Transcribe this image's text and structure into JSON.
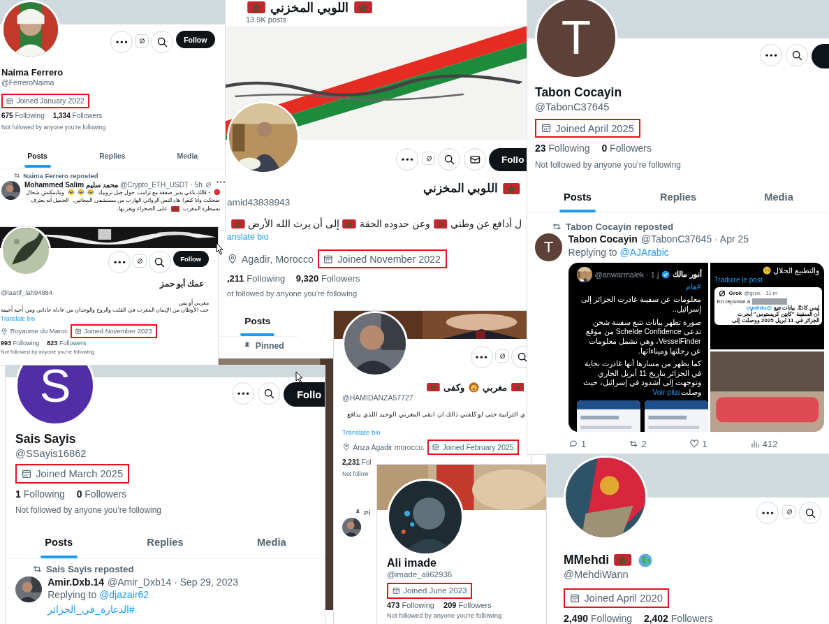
{
  "panels": [
    {
      "cover": {
        "kind": "plain"
      },
      "avatar": {
        "kind": "picture"
      },
      "actions": [
        {
          "kind": "more"
        },
        {
          "kind": "grok"
        },
        {
          "kind": "search"
        },
        {
          "kind": "follow",
          "label": "Follow"
        }
      ],
      "name": [
        {
          "kind": "text",
          "text": "Naima Ferrero"
        }
      ],
      "handle": "@FerreroNaima",
      "joined": "Joined January 2022",
      "following": {
        "count": "675",
        "label": "Following"
      },
      "followers": {
        "count": "1,334",
        "label": "Followers"
      },
      "not_followed": "Not followed by anyone you’re following",
      "tabs": [
        {
          "label": "Posts",
          "selected": true
        },
        {
          "label": "Replies",
          "selected": false
        },
        {
          "label": "Media",
          "selected": false
        }
      ],
      "post": {
        "reposted_by": "Naima Ferrero reposted",
        "avatar": {
          "kind": "picture"
        },
        "author": "Mohammed Salim محمد سليم",
        "meta": "@Crypto_ETH_USDT · 5h",
        "tools": true,
        "parts": [
          {
            "kind": "red-dot"
          },
          {
            "kind": "text",
            "text": "- قالك باغي يدير صفقة مع ترامب حول جبل تروبيك"
          },
          {
            "kind": "laugh"
          },
          {
            "kind": "laugh"
          },
          {
            "kind": "laugh"
          },
          {
            "kind": "text",
            "text": "ومايمكنش شحال"
          },
          {
            "kind": "text",
            "text": "ضحكت وأنا كنقرا هاد النص الروائي الهارب من مستشفى المجانين."
          },
          {
            "kind": "text",
            "text": "الجميل أنه يعترف"
          },
          {
            "kind": "text",
            "text": "بسيطرة المغرب"
          },
          {
            "kind": "flag"
          },
          {
            "kind": "text",
            "text": "على الصحراء ويقر بها."
          }
        ]
      }
    },
    {
      "header": {
        "title": [
          {
            "kind": "flag"
          },
          {
            "kind": "text",
            "text": "اللوبي المخزني"
          },
          {
            "kind": "flag"
          }
        ],
        "posts": "13.9K posts"
      },
      "cover": {
        "kind": "picture"
      },
      "avatar": {
        "kind": "picture"
      },
      "actions": [
        {
          "kind": "more"
        },
        {
          "kind": "grok"
        },
        {
          "kind": "search"
        },
        {
          "kind": "mail"
        },
        {
          "kind": "follow",
          "label": "Follo"
        }
      ],
      "name": [
        {
          "kind": "flag"
        },
        {
          "kind": "text",
          "text": "اللوبي المخزني"
        }
      ],
      "handle": "amid43838943",
      "bio": [
        [
          {
            "kind": "text",
            "text": "ل أدافع عن وطني"
          },
          {
            "kind": "flag"
          },
          {
            "kind": "text",
            "text": "وعن حدوده الحقة"
          },
          {
            "kind": "flag"
          },
          {
            "kind": "text",
            "text": "إلى أن يرث الله الأرض"
          },
          {
            "kind": "flag"
          }
        ]
      ],
      "translate": "anslate bio",
      "location": "Agadir, Morocco",
      "joined": "Joined November 2022",
      "following": {
        "count": ",211",
        "label": "Following"
      },
      "followers": {
        "count": "9,320",
        "label": "Followers"
      },
      "not_followed": "ot followed by anyone you’re following",
      "tabs": [
        {
          "label": "Posts",
          "selected": true
        }
      ],
      "post": {
        "pinned": "Pinned",
        "media": {
          "kind": "picture"
        }
      }
    },
    {
      "cover": {
        "kind": "plain"
      },
      "avatar": {
        "kind": "letter",
        "letter": "T",
        "color": "#5d4037"
      },
      "actions": [
        {
          "kind": "more"
        },
        {
          "kind": "search"
        },
        {
          "kind": "follow"
        }
      ],
      "name": [
        {
          "kind": "text",
          "text": "Tabon Cocayin"
        }
      ],
      "handle": "@TabonC37645",
      "joined": "Joined April 2025",
      "following": {
        "count": "23",
        "label": "Following"
      },
      "followers": {
        "count": "0",
        "label": "Followers"
      },
      "not_followed": "Not followed by anyone you’re following",
      "tabs": [
        {
          "label": "Posts",
          "selected": true
        },
        {
          "label": "Replies",
          "selected": false
        },
        {
          "label": "Media",
          "selected": false
        }
      ],
      "post": {
        "reposted_by": "Tabon Cocayin reposted",
        "avatar": {
          "kind": "letter",
          "letter": "T",
          "color": "#5d4037"
        },
        "author": "Tabon Cocayin",
        "meta": "@TabonC37645 · Apr 25",
        "replying": {
          "prefix": "Replying to",
          "handle": "@AJArabic"
        },
        "media": {
          "kind": "tweet-grid",
          "card": {
            "author": "أنور مالك",
            "meta": "@anwarmalek · 1 j",
            "hashtag": "#هام",
            "paragraphs": [
              "معلومات عن سفينة غادرت الجزائر إلى إسرائيل..",
              "صورة تظهر بيانات تتبع سفينة شحن تدعى Schelde Confidence من موقع VesselFinder، وهي تشمل معلومات عن رحلتها وميناءاتها.",
              "كما يظهر من مسارها أنها غادرت بجاية في الجزائر بتاريخ 11 أبريل الجاري وتوجهت إلى أشدود في إسرائيل، حيث وصلت"
            ],
            "more": "Voir plus"
          },
          "side": {
            "caption": "والتطبيع الحلال",
            "translate": "Traduire le post",
            "reply": {
              "author": "Grok",
              "meta": "@grok · 11 m",
              "prefix": "En réponse à",
              "mention": "@oualido",
              "lines": [
                "ليس كاذبًا. بيانات تتبع",
                "أن السفينة \"كابتن كريستوس\" أبحرت",
                "الجزائر في 11 أبريل 2025 ووصلت إلى"
              ]
            }
          }
        },
        "counts": [
          {
            "kind": "reply",
            "count": "1"
          },
          {
            "kind": "repost",
            "count": "2"
          },
          {
            "kind": "like",
            "count": "1"
          },
          {
            "kind": "views",
            "count": "412"
          }
        ]
      }
    },
    {
      "cover": {
        "kind": "picture"
      },
      "avatar": {
        "kind": "picture"
      },
      "actions": [
        {
          "kind": "more"
        },
        {
          "kind": "grok"
        },
        {
          "kind": "search"
        },
        {
          "kind": "follow",
          "label": "Follow"
        }
      ],
      "name": [
        {
          "kind": "text",
          "text": "عمك أبو حمز"
        }
      ],
      "handle": "@laarif_lah94884",
      "bio": [
        [
          {
            "kind": "text",
            "text": "مغربي أو بس"
          }
        ],
        [
          {
            "kind": "text",
            "text": "حب الأوطان من الإيمان المغرب في القلب والروح والوجدان من عاداه عاداني ومن أحبه أحببته"
          }
        ]
      ],
      "translate": "Translate bio",
      "location": "Royaume du Maroc",
      "joined": "Joined November 2023",
      "following": {
        "count": "993",
        "label": "Following"
      },
      "followers": {
        "count": "823",
        "label": "Followers"
      },
      "not_followed": "Not followed by anyone you’re following"
    },
    {
      "cover": {
        "kind": "plain"
      },
      "avatar": {
        "kind": "letter",
        "letter": "S",
        "color": "#512da8"
      },
      "actions": [
        {
          "kind": "more"
        },
        {
          "kind": "search"
        },
        {
          "kind": "follow",
          "label": "Follo"
        }
      ],
      "name": [
        {
          "kind": "text",
          "text": "Sais Sayis"
        }
      ],
      "handle": "@SSayis16862",
      "joined": "Joined March 2025",
      "following": {
        "count": "1",
        "label": "Following"
      },
      "followers": {
        "count": "0",
        "label": "Followers"
      },
      "not_followed": "Not followed by anyone you’re following",
      "tabs": [
        {
          "label": "Posts",
          "selected": true
        },
        {
          "label": "Replies",
          "selected": false
        },
        {
          "label": "Media",
          "selected": false
        }
      ],
      "post": {
        "reposted_by": "Sais Sayis reposted",
        "avatar": {
          "kind": "picture"
        },
        "author": "Amir.Dxb.14",
        "meta": "@Amir_Dxb14 · Sep 29, 2023",
        "replying": {
          "prefix": "Replying to",
          "handle": "@djazair62"
        },
        "hashtag": "#الدعارة_في_الجزائر"
      }
    },
    {
      "cover": {
        "kind": "picture"
      },
      "avatar": {
        "kind": "picture"
      },
      "actions": [
        {
          "kind": "more"
        },
        {
          "kind": "grok"
        },
        {
          "kind": "search"
        }
      ],
      "name": [
        {
          "kind": "flag"
        },
        {
          "kind": "text",
          "text": "مغربي"
        },
        {
          "kind": "lion"
        },
        {
          "kind": "text",
          "text": "وكفى"
        },
        {
          "kind": "flag"
        }
      ],
      "handle": "@HAMIDANZA57727",
      "bio": [
        [
          {
            "kind": "text",
            "text": "ي الترابية حتى لو كلفني ذالك ان ابقى المغربي الوحيد اللذي يدافع"
          }
        ]
      ],
      "translate": "Translate bio",
      "location": "Anza Agadir morocco.",
      "joined": "Joined February 2025",
      "following": {
        "count": "2,231",
        "label": "Fol"
      },
      "not_followed": "Not follow",
      "post": {
        "pinned": "Pi",
        "avatar": {
          "kind": "picture"
        }
      }
    },
    {
      "cover": {
        "kind": "picture"
      },
      "avatar": {
        "kind": "picture"
      },
      "name": [
        {
          "kind": "text",
          "text": "Ali imade"
        }
      ],
      "handle": "@imade_ali62936",
      "joined": "Joined June 2023",
      "following": {
        "count": "473",
        "label": "Following"
      },
      "followers": {
        "count": "209",
        "label": "Followers"
      },
      "not_followed": "Not followed by anyone you’re following"
    },
    {
      "cover": {
        "kind": "plain"
      },
      "avatar": {
        "kind": "picture"
      },
      "actions": [
        {
          "kind": "more"
        },
        {
          "kind": "grok"
        },
        {
          "kind": "search"
        }
      ],
      "name": [
        {
          "kind": "text",
          "text": "MMehdi"
        },
        {
          "kind": "flag"
        },
        {
          "kind": "globe"
        }
      ],
      "handle": "@MehdiWann",
      "joined": "Joined April 2020",
      "following": {
        "count": "2,490",
        "label": "Following"
      },
      "followers": {
        "count": "2,402",
        "label": "Followers"
      }
    }
  ]
}
